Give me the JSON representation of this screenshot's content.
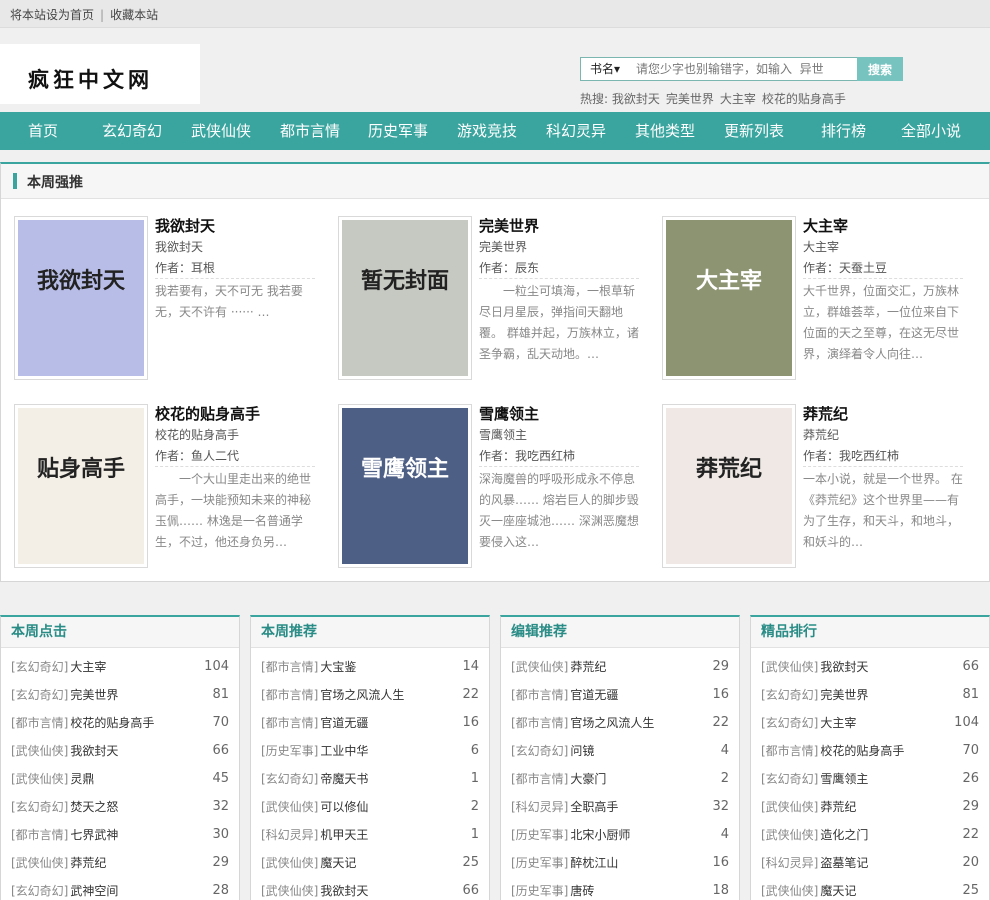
{
  "topbar": {
    "set_home": "将本站设为首页",
    "separator": "|",
    "bookmark": "收藏本站"
  },
  "logo": {
    "text": "疯狂中文网"
  },
  "search": {
    "select_label": "书名▾",
    "placeholder": "请您少字也别输错字，如输入  异世",
    "button": "搜索"
  },
  "hot": {
    "label": "热搜:",
    "items": [
      "我欲封天",
      "完美世界",
      "大主宰",
      "校花的贴身高手"
    ]
  },
  "nav": [
    "首页",
    "玄幻奇幻",
    "武侠仙侠",
    "都市言情",
    "历史军事",
    "游戏竞技",
    "科幻灵异",
    "其他类型",
    "更新列表",
    "排行榜",
    "全部小说"
  ],
  "strong": {
    "title": "本周强推",
    "books": [
      {
        "title": "我欲封天",
        "sub": "我欲封天",
        "author": "作者：耳根",
        "desc": "我若要有，天不可无 我若要无，天不许有 ······ …",
        "cover_text": "我欲封天",
        "cover_color": "#b8bde8"
      },
      {
        "title": "完美世界",
        "sub": "完美世界",
        "author": "作者：辰东",
        "desc": "　　一粒尘可填海，一根草斩尽日月星辰，弹指间天翻地覆。 群雄并起，万族林立，诸圣争霸，乱天动地。…",
        "cover_text": "暂无封面",
        "cover_color": "#c6c8c2"
      },
      {
        "title": "大主宰",
        "sub": "大主宰",
        "author": "作者：天蚕土豆",
        "desc": "大千世界，位面交汇，万族林立，群雄荟萃，一位位来自下位面的天之至尊，在这无尽世界，演绎着令人向往…",
        "cover_text": "大主宰",
        "cover_color": "#8d9472"
      },
      {
        "title": "校花的贴身高手",
        "sub": "校花的贴身高手",
        "author": "作者：鱼人二代",
        "desc": "　　一个大山里走出来的绝世高手，一块能预知未来的神秘玉佩…… 林逸是一名普通学生，不过，他还身负另…",
        "cover_text": "贴身高手",
        "cover_color": "#f3efe6"
      },
      {
        "title": "雪鹰领主",
        "sub": "雪鹰领主",
        "author": "作者：我吃西红柿",
        "desc": "深海魔兽的呼吸形成永不停息的风暴…… 熔岩巨人的脚步毁灭一座座城池…… 深渊恶魔想要侵入这…",
        "cover_text": "雪鹰领主",
        "cover_color": "#4e5f86"
      },
      {
        "title": "莽荒纪",
        "sub": "莽荒纪",
        "author": "作者：我吃西红柿",
        "desc": "一本小说，就是一个世界。 在《莽荒纪》这个世界里——有为了生存，和天斗，和地斗，和妖斗的…",
        "cover_text": "莽荒纪",
        "cover_color": "#efe8e4"
      }
    ]
  },
  "rankings": [
    {
      "title": "本周点击",
      "items": [
        {
          "cat": "[玄幻奇幻]",
          "name": "大主宰",
          "num": "104"
        },
        {
          "cat": "[玄幻奇幻]",
          "name": "完美世界",
          "num": "81"
        },
        {
          "cat": "[都市言情]",
          "name": "校花的贴身高手",
          "num": "70"
        },
        {
          "cat": "[武侠仙侠]",
          "name": "我欲封天",
          "num": "66"
        },
        {
          "cat": "[武侠仙侠]",
          "name": "灵鼎",
          "num": "45"
        },
        {
          "cat": "[玄幻奇幻]",
          "name": "焚天之怒",
          "num": "32"
        },
        {
          "cat": "[都市言情]",
          "name": "七界武神",
          "num": "30"
        },
        {
          "cat": "[武侠仙侠]",
          "name": "莽荒纪",
          "num": "29"
        },
        {
          "cat": "[玄幻奇幻]",
          "name": "武神空间",
          "num": "28"
        }
      ]
    },
    {
      "title": "本周推荐",
      "items": [
        {
          "cat": "[都市言情]",
          "name": "大宝鉴",
          "num": "14"
        },
        {
          "cat": "[都市言情]",
          "name": "官场之风流人生",
          "num": "22"
        },
        {
          "cat": "[都市言情]",
          "name": "官道无疆",
          "num": "16"
        },
        {
          "cat": "[历史军事]",
          "name": "工业中华",
          "num": "6"
        },
        {
          "cat": "[玄幻奇幻]",
          "name": "帝魔天书",
          "num": "1"
        },
        {
          "cat": "[武侠仙侠]",
          "name": "可以修仙",
          "num": "2"
        },
        {
          "cat": "[科幻灵异]",
          "name": "机甲天王",
          "num": "1"
        },
        {
          "cat": "[武侠仙侠]",
          "name": "魔天记",
          "num": "25"
        },
        {
          "cat": "[武侠仙侠]",
          "name": "我欲封天",
          "num": "66"
        }
      ]
    },
    {
      "title": "编辑推荐",
      "items": [
        {
          "cat": "[武侠仙侠]",
          "name": "莽荒纪",
          "num": "29"
        },
        {
          "cat": "[都市言情]",
          "name": "官道无疆",
          "num": "16"
        },
        {
          "cat": "[都市言情]",
          "name": "官场之风流人生",
          "num": "22"
        },
        {
          "cat": "[玄幻奇幻]",
          "name": "问镜",
          "num": "4"
        },
        {
          "cat": "[都市言情]",
          "name": "大豪门",
          "num": "2"
        },
        {
          "cat": "[科幻灵异]",
          "name": "全职高手",
          "num": "32"
        },
        {
          "cat": "[历史军事]",
          "name": "北宋小厨师",
          "num": "4"
        },
        {
          "cat": "[历史军事]",
          "name": "醉枕江山",
          "num": "16"
        },
        {
          "cat": "[历史军事]",
          "name": "唐砖",
          "num": "18"
        }
      ]
    },
    {
      "title": "精品排行",
      "items": [
        {
          "cat": "[武侠仙侠]",
          "name": "我欲封天",
          "num": "66"
        },
        {
          "cat": "[玄幻奇幻]",
          "name": "完美世界",
          "num": "81"
        },
        {
          "cat": "[玄幻奇幻]",
          "name": "大主宰",
          "num": "104"
        },
        {
          "cat": "[都市言情]",
          "name": "校花的贴身高手",
          "num": "70"
        },
        {
          "cat": "[玄幻奇幻]",
          "name": "雪鹰领主",
          "num": "26"
        },
        {
          "cat": "[武侠仙侠]",
          "name": "莽荒纪",
          "num": "29"
        },
        {
          "cat": "[武侠仙侠]",
          "name": "造化之门",
          "num": "22"
        },
        {
          "cat": "[科幻灵异]",
          "name": "盗墓笔记",
          "num": "20"
        },
        {
          "cat": "[武侠仙侠]",
          "name": "魔天记",
          "num": "25"
        }
      ]
    }
  ]
}
